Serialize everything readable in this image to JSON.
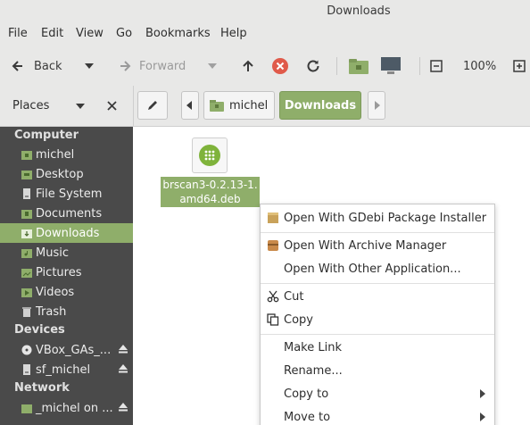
{
  "window": {
    "title": "Downloads"
  },
  "menu": [
    "File",
    "Edit",
    "View",
    "Go",
    "Bookmarks",
    "Help"
  ],
  "toolbar": {
    "back": "Back",
    "forward": "Forward",
    "zoom": "100%",
    "icons": [
      "back-arrow-icon",
      "chevron-down-icon",
      "forward-arrow-icon",
      "up-arrow-icon",
      "stop-icon",
      "reload-icon",
      "folder-icon",
      "computer-icon",
      "zoom-out-icon",
      "zoom-in-icon"
    ]
  },
  "places_header": {
    "label": "Places"
  },
  "breadcrumb": [
    "michel",
    "Downloads"
  ],
  "sidebar": {
    "sections": [
      {
        "title": "Computer",
        "items": [
          "michel",
          "Desktop",
          "File System",
          "Documents",
          "Downloads",
          "Music",
          "Pictures",
          "Videos",
          "Trash"
        ]
      },
      {
        "title": "Devices",
        "items": [
          "VBox_GAs_...",
          "sf_michel"
        ]
      },
      {
        "title": "Network",
        "items": [
          "_michel on ..."
        ]
      }
    ],
    "selected": "Downloads"
  },
  "file": {
    "name_line1": "brscan3-0.2.13-1.",
    "name_line2": "amd64.deb"
  },
  "context_menu": {
    "open_gdebi": "Open With GDebi Package Installer",
    "open_archive": "Open With Archive Manager",
    "open_other": "Open With Other Application...",
    "cut": "Cut",
    "copy": "Copy",
    "make_link": "Make Link",
    "rename": "Rename...",
    "copy_to": "Copy to",
    "move_to": "Move to"
  },
  "colors": {
    "accent": "#8fae6a",
    "sidebar_bg": "#4a4a4a",
    "stop_red": "#e05a4a"
  }
}
